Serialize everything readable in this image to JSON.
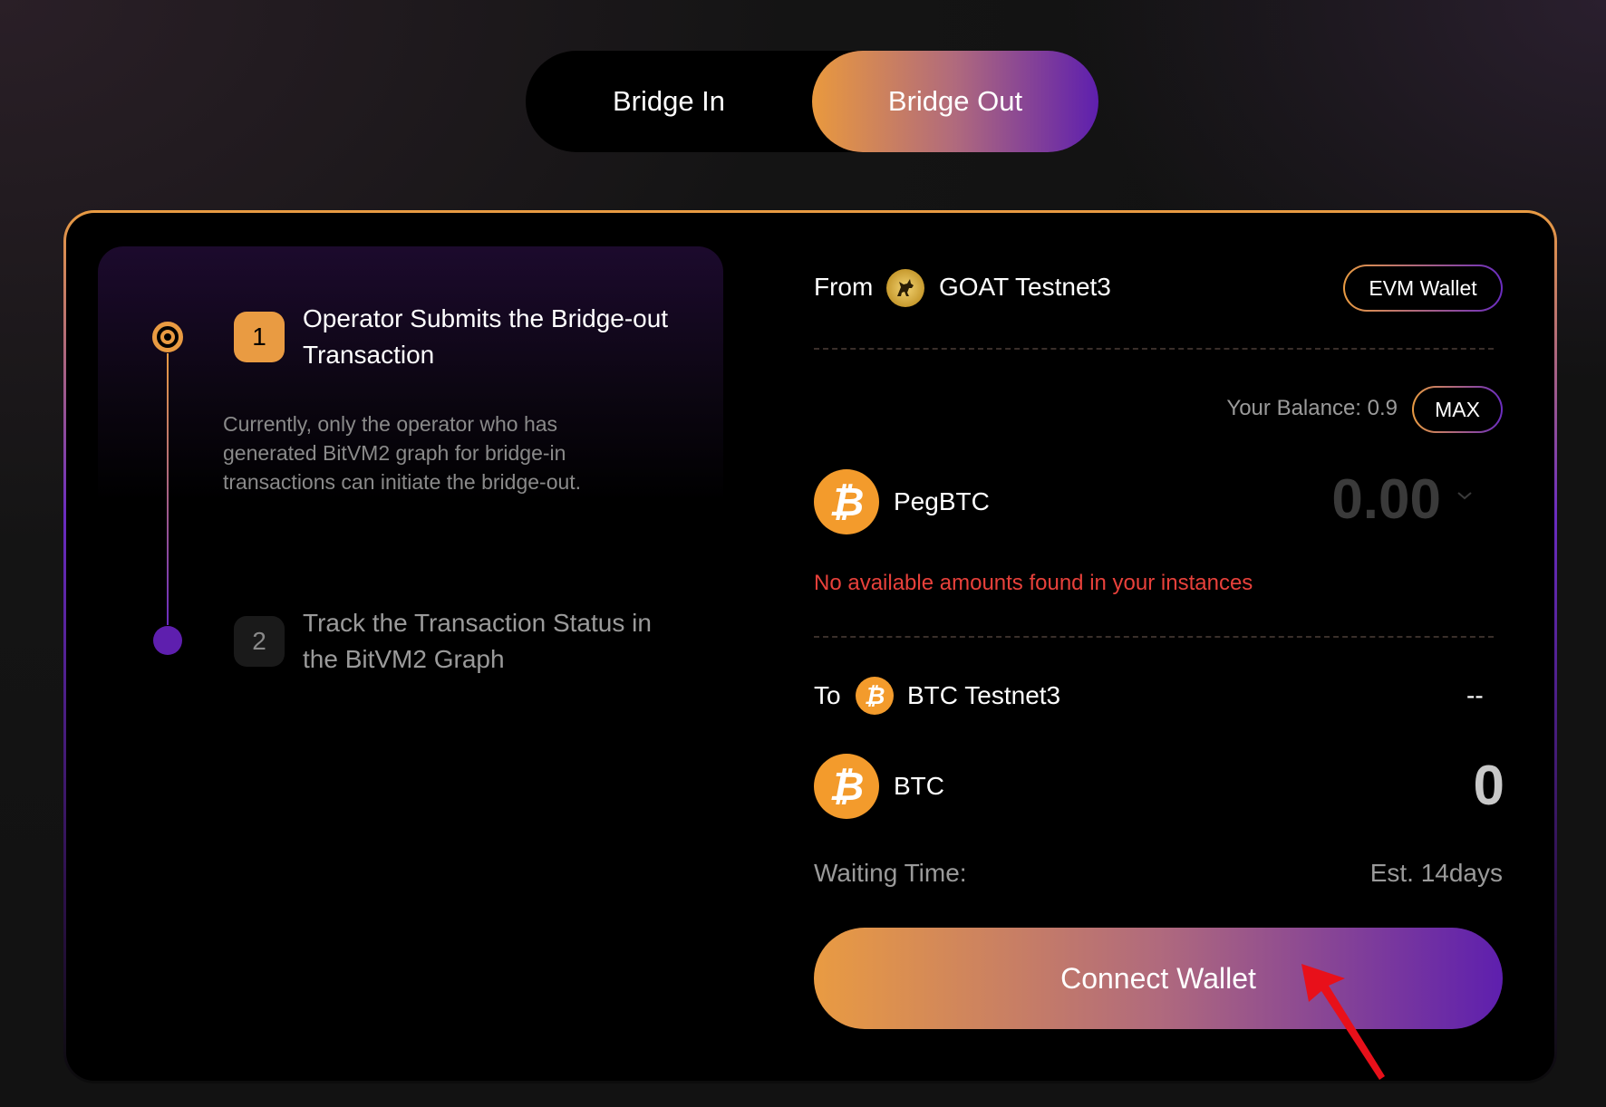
{
  "tabs": {
    "bridge_in": "Bridge In",
    "bridge_out": "Bridge Out"
  },
  "steps": [
    {
      "number": "1",
      "title": "Operator Submits the Bridge-out Transaction",
      "description": "Currently, only the operator who has generated BitVM2 graph for bridge-in transactions can initiate the bridge-out."
    },
    {
      "number": "2",
      "title": "Track the Transaction Status in the BitVM2 Graph"
    }
  ],
  "from": {
    "label": "From",
    "network": "GOAT Testnet3",
    "wallet_button": "EVM Wallet",
    "balance": "Your Balance: 0.9",
    "max_button": "MAX",
    "token": "PegBTC",
    "amount": "0.00",
    "error": "No available amounts found in your instances"
  },
  "to": {
    "label": "To",
    "network": "BTC Testnet3",
    "address": "--",
    "token": "BTC",
    "amount": "0"
  },
  "waiting": {
    "label": "Waiting Time:",
    "value": "Est. 14days"
  },
  "connect_button": "Connect Wallet",
  "colors": {
    "accent_orange": "#e99b42",
    "accent_purple": "#5e1fae",
    "error": "#e8413b",
    "btc": "#f39b2c"
  }
}
